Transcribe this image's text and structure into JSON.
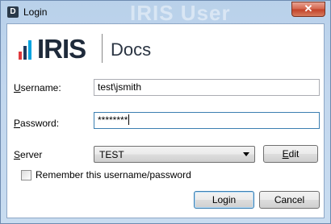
{
  "window": {
    "title": "Login",
    "icon_letter": "D",
    "watermark": "IRIS User",
    "close_symbol": "✕"
  },
  "logo": {
    "brand": "IRIS",
    "product": "Docs",
    "bar_colors": [
      "#e03a3e",
      "#1f3a5f",
      "#00a3e0"
    ]
  },
  "form": {
    "username_label": "Username:",
    "username_value": "test\\jsmith",
    "password_label": "Password:",
    "password_value": "********",
    "server_label": "Server",
    "server_value": "TEST",
    "edit_button": "Edit",
    "remember_label": "Remember this username/password",
    "remember_checked": false
  },
  "actions": {
    "login_button": "Login",
    "cancel_button": "Cancel"
  }
}
